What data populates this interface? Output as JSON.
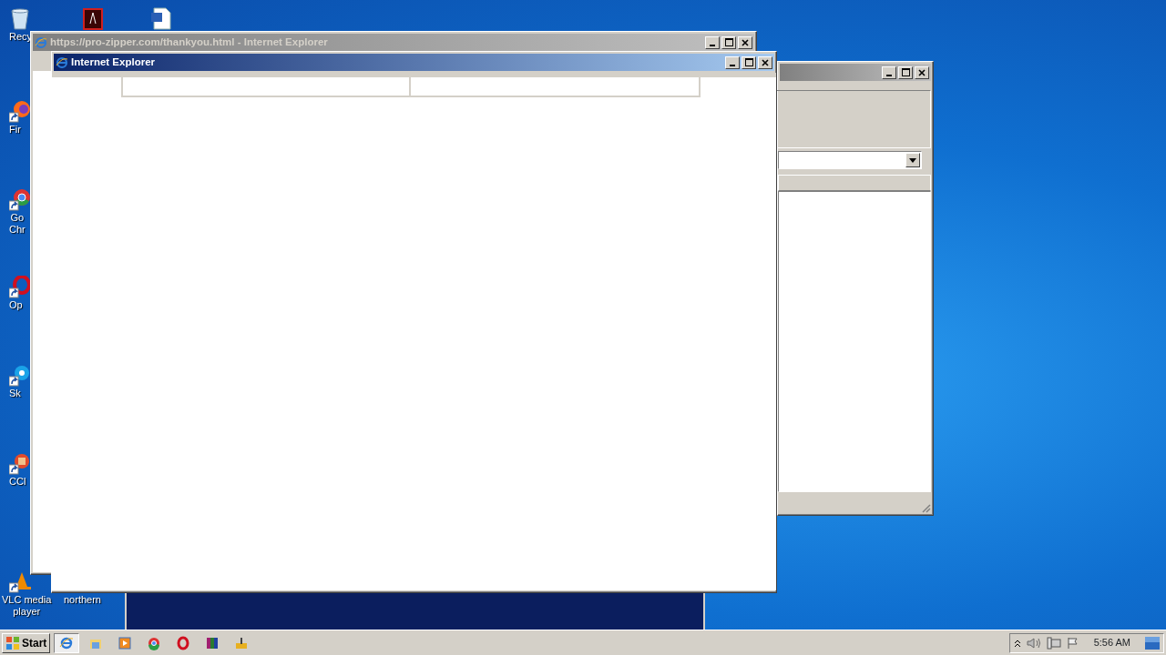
{
  "desktop_icons": [
    {
      "kind": "recycle-bin",
      "label_lines": [
        "Recy"
      ]
    },
    {
      "kind": "acrobat"
    },
    {
      "kind": "word-doc"
    },
    {
      "kind": "firefox",
      "label_lines": [
        "Fir"
      ]
    },
    {
      "kind": "chrome",
      "label_lines": [
        "Go",
        "Chr"
      ]
    },
    {
      "kind": "opera",
      "label_lines": [
        "Op"
      ]
    },
    {
      "kind": "skype",
      "label_lines": [
        "Sk"
      ]
    },
    {
      "kind": "ccleaner",
      "label_lines": [
        "CCl"
      ]
    },
    {
      "kind": "vlc",
      "label_lines": [
        "VLC media",
        "player"
      ]
    },
    {
      "kind": "northern",
      "label_lines": [
        "northern"
      ]
    }
  ],
  "windows": [
    {
      "kind": "dialog",
      "active": false
    },
    {
      "kind": "browser",
      "title": "https://pro-zipper.com/thankyou.html - Internet Explorer",
      "active": false
    },
    {
      "kind": "popup",
      "title": "Internet Explorer",
      "active": true
    }
  ],
  "taskbar": {
    "start": "Start",
    "items": [
      {
        "kind": "ie",
        "selected": true
      },
      {
        "kind": "explorer",
        "selected": false
      },
      {
        "kind": "media",
        "selected": false
      },
      {
        "kind": "chrome",
        "selected": false
      },
      {
        "kind": "opera",
        "selected": false
      },
      {
        "kind": "winrar",
        "selected": false
      },
      {
        "kind": "setup",
        "selected": false
      }
    ],
    "clock": "5:56 AM"
  }
}
